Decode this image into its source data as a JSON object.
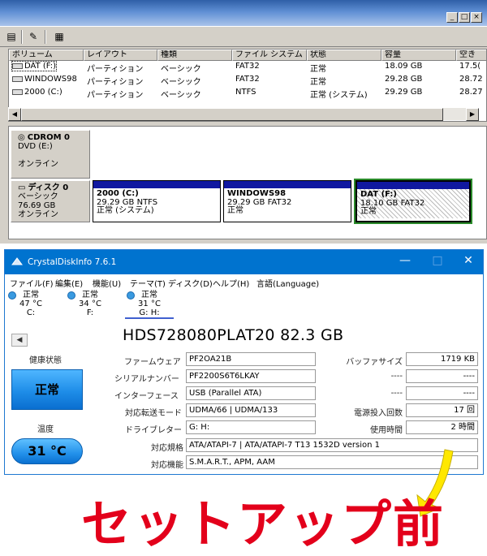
{
  "disk_mgmt": {
    "columns": [
      "ボリューム",
      "レイアウト",
      "種類",
      "ファイル システム",
      "状態",
      "容量",
      "空き"
    ],
    "volumes": [
      {
        "name": "DAT (F:)",
        "layout": "パーティション",
        "type": "ベーシック",
        "fs": "FAT32",
        "status": "正常",
        "capacity": "18.09 GB",
        "free": "17.5("
      },
      {
        "name": "WINDOWS98",
        "layout": "パーティション",
        "type": "ベーシック",
        "fs": "FAT32",
        "status": "正常",
        "capacity": "29.28 GB",
        "free": "28.72"
      },
      {
        "name": "2000 (C:)",
        "layout": "パーティション",
        "type": "ベーシック",
        "fs": "NTFS",
        "status": "正常 (システム)",
        "capacity": "29.29 GB",
        "free": "28.27"
      }
    ],
    "cdrom": {
      "name": "CDROM 0",
      "drive": "DVD (E:)",
      "status": "オンライン"
    },
    "disk0": {
      "name": "ディスク 0",
      "type": "ベーシック",
      "size": "76.69 GB",
      "status": "オンライン"
    },
    "partitions": [
      {
        "name": "2000 (C:)",
        "detail": "29.29 GB NTFS",
        "status": "正常 (システム)"
      },
      {
        "name": "WINDOWS98",
        "detail": "29.29 GB FAT32",
        "status": "正常"
      },
      {
        "name": "DAT (F:)",
        "detail": "18.10 GB FAT32",
        "status": "正常"
      }
    ]
  },
  "cdi": {
    "title": "CrystalDiskInfo 7.6.1",
    "menu": [
      "ファイル(F)",
      "編集(E)",
      "機能(U)",
      "テーマ(T)",
      "ディスク(D)",
      "ヘルプ(H)",
      "言語(Language)"
    ],
    "disk_tabs": [
      {
        "status": "正常",
        "temp": "47 °C",
        "drive": "C:"
      },
      {
        "status": "正常",
        "temp": "34 °C",
        "drive": "F:"
      },
      {
        "status": "正常",
        "temp": "31 °C",
        "drive": "G: H:"
      }
    ],
    "model": "HDS728080PLAT20 82.3 GB",
    "health_label": "健康状態",
    "health_value": "正常",
    "temp_label": "温度",
    "temp_value": "31 °C",
    "labels": {
      "firmware": "ファームウェア",
      "serial": "シリアルナンバー",
      "interface": "インターフェース",
      "transfer": "対応転送モード",
      "drive_letter": "ドライブレター",
      "standard": "対応規格",
      "features": "対応機能",
      "buffer": "バッファサイズ",
      "blank1": "----",
      "blank2": "----",
      "power_count": "電源投入回数",
      "power_hours": "使用時間"
    },
    "values": {
      "firmware": "PF2OA21B",
      "serial": "PF2200S6T6LKAY",
      "interface": "USB (Parallel ATA)",
      "transfer": "UDMA/66 | UDMA/133",
      "drive_letter": "G: H:",
      "standard": "ATA/ATAPI-7 | ATA/ATAPI-7 T13 1532D version 1",
      "features": "S.M.A.R.T., APM, AAM",
      "buffer": "1719 KB",
      "blank1": "----",
      "blank2": "----",
      "power_count": "17 回",
      "power_hours": "2 時間"
    }
  },
  "caption": "セットアップ前",
  "colors": {
    "caption": "#e3001b",
    "arrow": "#ffe800",
    "cdi_title": "#0073cf",
    "health": "#1e8de8"
  }
}
